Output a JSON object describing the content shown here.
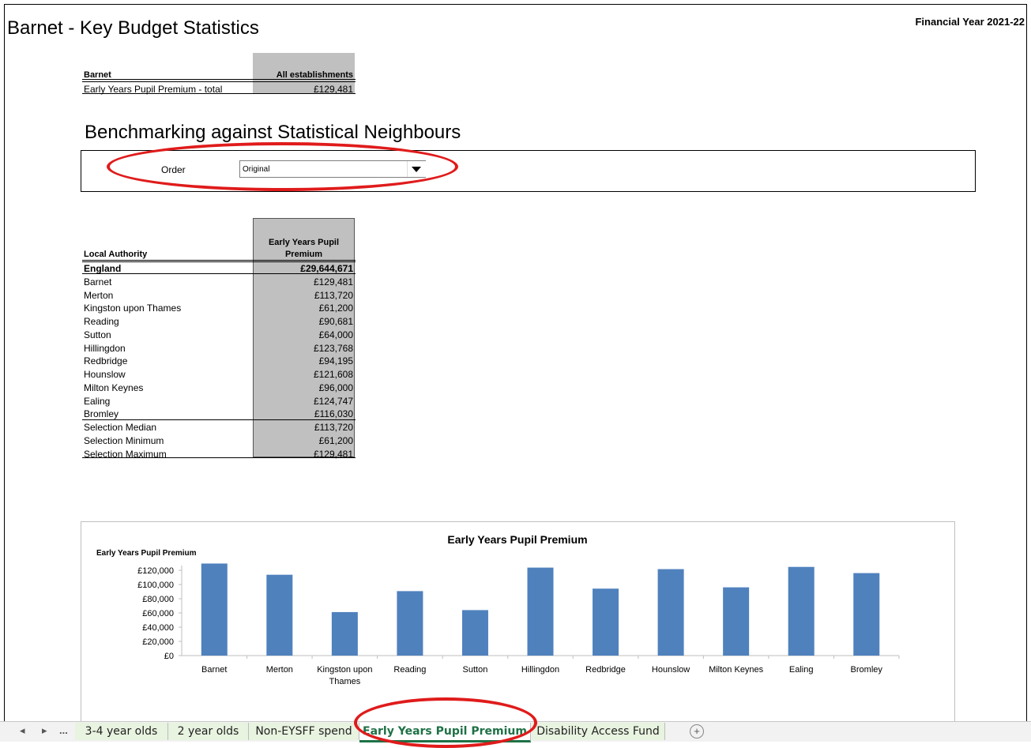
{
  "title": "Barnet - Key Budget Statistics",
  "financial_year": "Financial Year 2021-22",
  "summary": {
    "col_la": "Barnet",
    "col_all": "All establishments",
    "row_label": "Early Years Pupil Premium - total",
    "row_value": "£129,481"
  },
  "benchmark": {
    "title": "Benchmarking against Statistical Neighbours",
    "order_label": "Order",
    "order_value": "Original"
  },
  "table": {
    "header_la": "Local Authority",
    "header_col_line1": "Early Years Pupil",
    "header_col_line2": "Premium",
    "rows": [
      {
        "label": "England",
        "value": "£29,644,671"
      },
      {
        "label": "Barnet",
        "value": "£129,481"
      },
      {
        "label": "Merton",
        "value": "£113,720"
      },
      {
        "label": "Kingston upon Thames",
        "value": "£61,200"
      },
      {
        "label": "Reading",
        "value": "£90,681"
      },
      {
        "label": "Sutton",
        "value": "£64,000"
      },
      {
        "label": "Hillingdon",
        "value": "£123,768"
      },
      {
        "label": "Redbridge",
        "value": "£94,195"
      },
      {
        "label": "Hounslow",
        "value": "£121,608"
      },
      {
        "label": "Milton Keynes",
        "value": "£96,000"
      },
      {
        "label": "Ealing",
        "value": "£124,747"
      },
      {
        "label": "Bromley",
        "value": "£116,030"
      },
      {
        "label": "Selection Median",
        "value": "£113,720"
      },
      {
        "label": "Selection Minimum",
        "value": "£61,200"
      },
      {
        "label": "Selection Maximum",
        "value": "£129,481"
      }
    ]
  },
  "chart_data": {
    "type": "bar",
    "title": "Early Years Pupil Premium",
    "ylabel": "Early Years Pupil Premium",
    "categories": [
      "Barnet",
      "Merton",
      "Kingston upon Thames",
      "Reading",
      "Sutton",
      "Hillingdon",
      "Redbridge",
      "Hounslow",
      "Milton Keynes",
      "Ealing",
      "Bromley"
    ],
    "values": [
      129481,
      113720,
      61200,
      90681,
      64000,
      123768,
      94195,
      121608,
      96000,
      124747,
      116030
    ],
    "yticks": [
      "£0",
      "£20,000",
      "£40,000",
      "£60,000",
      "£80,000",
      "£100,000",
      "£120,000"
    ],
    "ylim": [
      0,
      120000
    ],
    "bar_color": "#4f81bd",
    "grid": false
  },
  "tabs": {
    "ellipsis": "...",
    "items": [
      "3-4 year olds",
      "2 year olds",
      "Non-EYSFF spend",
      "Early Years Pupil Premium",
      "Disability Access Fund"
    ],
    "active_index": 3,
    "add": "+"
  },
  "annotation_color": "#e01b1b"
}
